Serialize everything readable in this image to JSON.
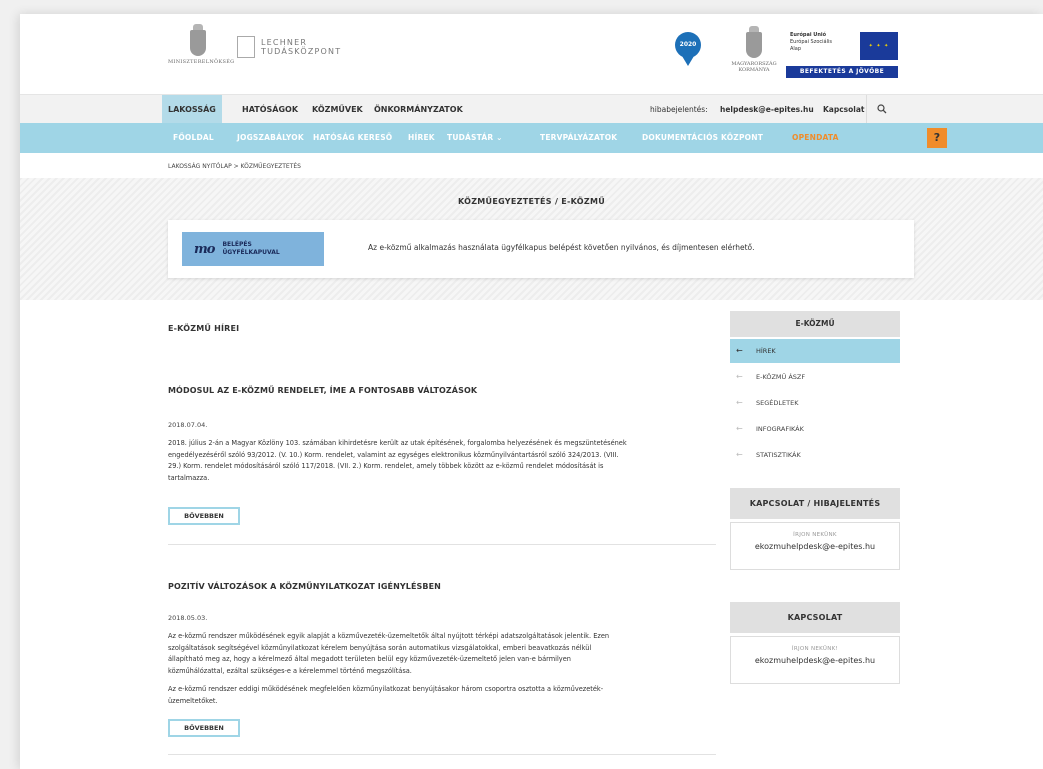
{
  "header": {
    "ministry_caption": "MINISZTERELNÖKSÉG",
    "lechner_line1": "LECHNER",
    "lechner_line2": "TUDÁSKÖZPONT",
    "badge_2020": "2020",
    "gov_caption_line1": "MAGYARORSZÁG",
    "gov_caption_line2": "KORMÁNYA",
    "eu_line1": "Európai Unió",
    "eu_line2": "Európai Szociális",
    "eu_line3": "Alap",
    "eu_banner": "BEFEKTETÉS A JÖVŐBE"
  },
  "topnav": {
    "items": [
      "LAKOSSÁG",
      "HATÓSÁGOK",
      "KÖZMŰVEK",
      "ÖNKORMÁNYZATOK"
    ],
    "error_label": "hibabejelentés:",
    "error_email": "helpdesk@e-epites.hu",
    "contact": "Kapcsolat"
  },
  "mainnav": {
    "items": [
      "FŐOLDAL",
      "JOGSZABÁLYOK",
      "HATÓSÁG KERESŐ",
      "HÍREK",
      "TUDÁSTÁR ⌄",
      "TERVPÁLYÁZATOK",
      "DOKUMENTÁCIÓS KÖZPONT",
      "OPENDATA"
    ],
    "help": "?"
  },
  "breadcrumb": "LAKOSSÁG NYITÓLAP > KÖZMŰEGYEZTETÉS",
  "hero": {
    "title": "KÖZMŰEGYEZTETÉS / E-KÖZMŰ",
    "login_mark": "mo",
    "login_line1": "BELÉPÉS",
    "login_line2": "ÜGYFÉLKAPUVAL",
    "message": "Az e-közmű alkalmazás használata ügyfélkapus belépést követően nyilvános, és díjmentesen elérhető."
  },
  "content": {
    "heading": "E-KÖZMŰ HÍREI",
    "articles": [
      {
        "title": "MÓDOSUL AZ E-KÖZMŰ RENDELET, ÍME A FONTOSABB VÁLTOZÁSOK",
        "date": "2018.07.04.",
        "lines": [
          "2018. július 2-án a Magyar Közlöny 103. számában kihirdetésre került az utak építésének, forgalomba helyezésének és megszüntetésének",
          "engedélyezéséről szóló 93/2012. (V. 10.) Korm. rendelet, valamint az egységes elektronikus közműnyilvántartásról szóló 324/2013. (VIII.",
          "29.) Korm. rendelet módosításáról szóló 117/2018. (VII. 2.) Korm. rendelet, amely többek között az e-közmű rendelet módosítását is",
          "tartalmazza."
        ],
        "more": "BŐVEBBEN"
      },
      {
        "title": "POZITÍV VÁLTOZÁSOK A KÖZMŰNYILATKOZAT IGÉNYLÉSBEN",
        "date": "2018.05.03.",
        "lines": [
          "Az e-közmű rendszer működésének egyik alapját a közművezeték-üzemeltetők által nyújtott térképi adatszolgáltatások jelentik. Ezen",
          "szolgáltatások segítségével közműnyilatkozat kérelem benyújtása során automatikus vizsgálatokkal, emberi beavatkozás nélkül",
          "állapítható meg az, hogy a kérelmező által megadott területen belül egy közművezeték-üzemeltető jelen van-e bármilyen",
          "közműhálózattal, ezáltal szükséges-e a kérelemmel történő megszólítása."
        ],
        "lines2": [
          "Az e-közmű rendszer eddigi működésének megfelelően közműnyilatkozat benyújtásakor három csoportra osztotta a közművezeték-",
          "üzemeltetőket."
        ],
        "more": "BŐVEBBEN"
      }
    ]
  },
  "sidebar": {
    "title": "E-KÖZMŰ",
    "items": [
      "HÍREK",
      "E-KÖZMŰ ÁSZF",
      "SEGÉDLETEK",
      "INFOGRAFIKÁK",
      "STATISZTIKÁK"
    ],
    "contact1": {
      "title": "KAPCSOLAT / HIBAJELENTÉS",
      "label": "ÍRJON NEKÜNK",
      "email": "ekozmuhelpdesk@e-epites.hu"
    },
    "contact2": {
      "title": "KAPCSOLAT",
      "label": "ÍRJON NEKÜNK!",
      "email": "ekozmuhelpdesk@e-epites.hu"
    }
  },
  "colors": {
    "accent_blue": "#9fd5e6",
    "orange": "#f08c2a",
    "login_blue": "#7fb3dc"
  }
}
